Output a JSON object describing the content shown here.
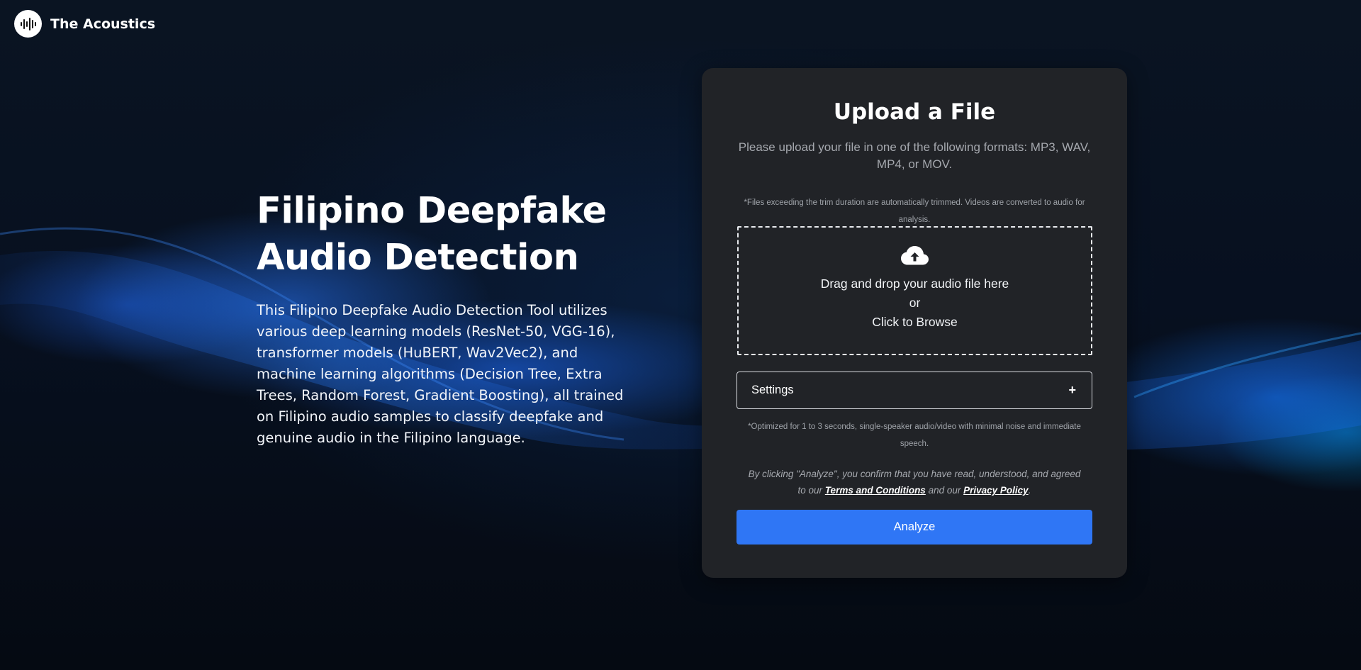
{
  "brand": {
    "name": "The Acoustics",
    "logo_icon": "waveform-icon"
  },
  "hero": {
    "title_line1": "Filipino Deepfake",
    "title_line2": "Audio Detection",
    "description": "This Filipino Deepfake Audio Detection Tool utilizes various deep learning models (ResNet-50, VGG-16), transformer models (HuBERT, Wav2Vec2), and machine learning algorithms (Decision Tree, Extra Trees, Random Forest, Gradient Boosting), all trained on Filipino audio samples to classify deepfake and genuine audio in the Filipino language."
  },
  "upload": {
    "title": "Upload a File",
    "subtitle": "Please upload your file in one of the following formats: MP3, WAV, MP4, or MOV.",
    "trim_note": "*Files exceeding the trim duration are automatically trimmed. Videos are converted to audio for analysis.",
    "dropzone": {
      "icon": "cloud-upload-icon",
      "line1": "Drag and drop your audio file here",
      "line2": "or",
      "line3": "Click to Browse"
    },
    "settings": {
      "label": "Settings",
      "toggle": "+"
    },
    "optimized_note": "*Optimized for 1 to 3 seconds, single-speaker audio/video with minimal noise and immediate speech.",
    "consent": {
      "prefix": "By clicking \"Analyze\", you confirm that you have read, understood, and agreed to our ",
      "terms_link": "Terms and Conditions",
      "middle": " and our ",
      "privacy_link": "Privacy Policy",
      "suffix": "."
    },
    "analyze_button": "Analyze"
  },
  "colors": {
    "card_background": "#212327",
    "accent_button": "#2f76f5",
    "page_background": "#060c16",
    "wave_glow": "#1f6fff"
  }
}
